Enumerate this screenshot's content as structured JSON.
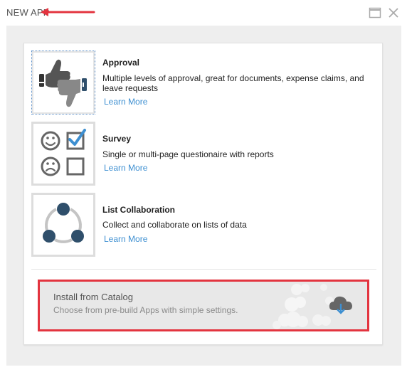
{
  "window": {
    "title": "NEW APP",
    "maximize_icon": "maximize-icon",
    "close_icon": "close-icon"
  },
  "apps": [
    {
      "title": "Approval",
      "description": "Multiple levels of approval, great for documents, expense claims, and leave requests",
      "link": "Learn More",
      "icon": "thumbs-up-down-icon",
      "selected": true
    },
    {
      "title": "Survey",
      "description": "Single or multi-page questionaire with reports",
      "link": "Learn More",
      "icon": "survey-faces-checkbox-icon",
      "selected": false
    },
    {
      "title": "List Collaboration",
      "description": "Collect and collaborate on lists of data",
      "link": "Learn More",
      "icon": "collaboration-cycle-icon",
      "selected": false
    }
  ],
  "catalog": {
    "title": "Install from Catalog",
    "subtitle": "Choose from pre-build Apps with simple settings.",
    "icon": "cloud-download-icon"
  },
  "colors": {
    "accent_link": "#3d8fd1",
    "highlight_outline": "#e3343f",
    "icon_dark": "#2f4f6b",
    "icon_blue": "#3d8fd1",
    "icon_gray": "#666666"
  }
}
